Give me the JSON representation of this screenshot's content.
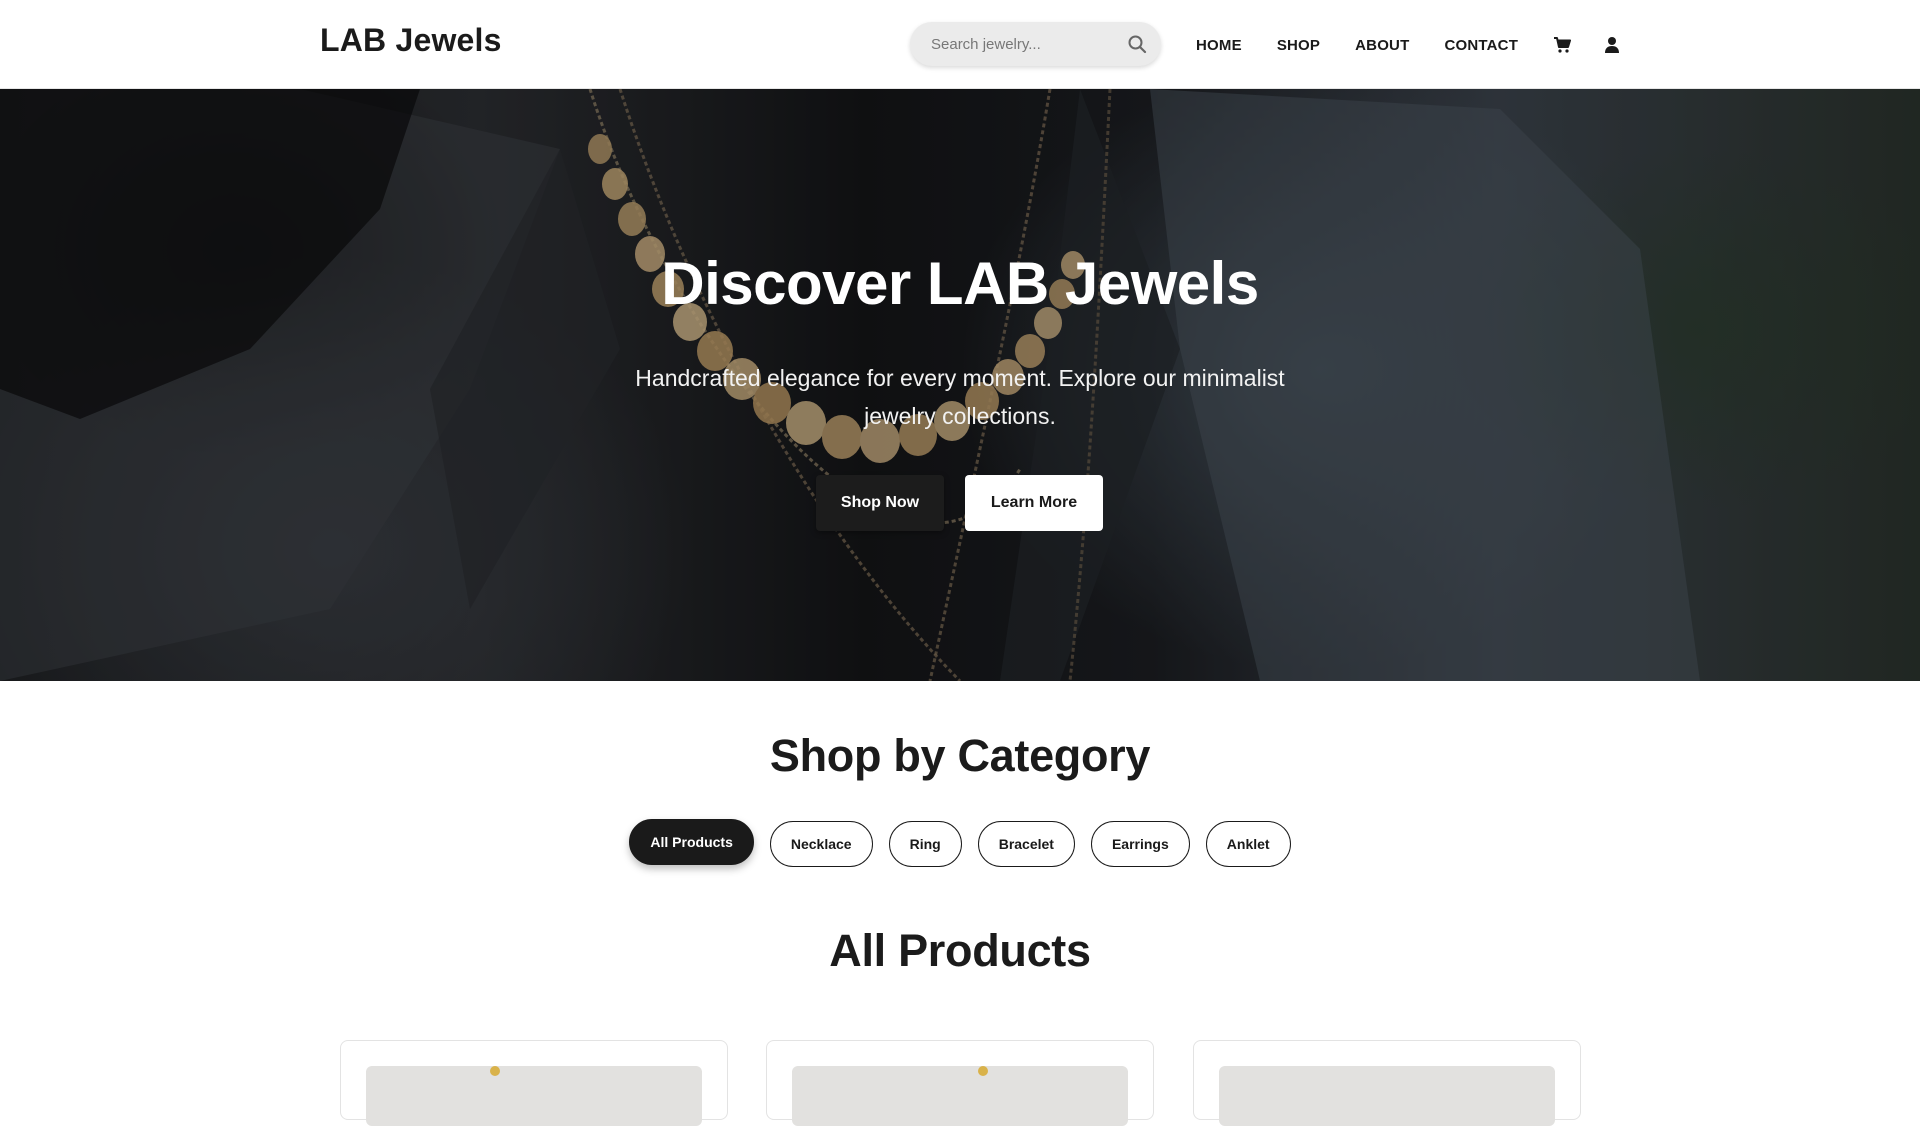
{
  "header": {
    "logo": "LAB Jewels",
    "search_placeholder": "Search jewelry...",
    "nav": [
      "HOME",
      "SHOP",
      "ABOUT",
      "CONTACT"
    ],
    "icons": [
      "search-icon",
      "cart-icon",
      "user-icon"
    ]
  },
  "hero": {
    "title": "Discover LAB Jewels",
    "subtitle": "Handcrafted elegance for every moment. Explore our minimalist jewelry collections.",
    "primary_button": "Shop Now",
    "secondary_button": "Learn More"
  },
  "categories": {
    "title": "Shop by Category",
    "items": [
      "All Products",
      "Necklace",
      "Ring",
      "Bracelet",
      "Earrings",
      "Anklet"
    ],
    "active": "All Products"
  },
  "products": {
    "title": "All Products",
    "card_count": 3
  },
  "colors": {
    "dark": "#1a1a1a",
    "white": "#ffffff",
    "search_bg": "#ebebeb",
    "card_border": "#e3e3e3"
  }
}
